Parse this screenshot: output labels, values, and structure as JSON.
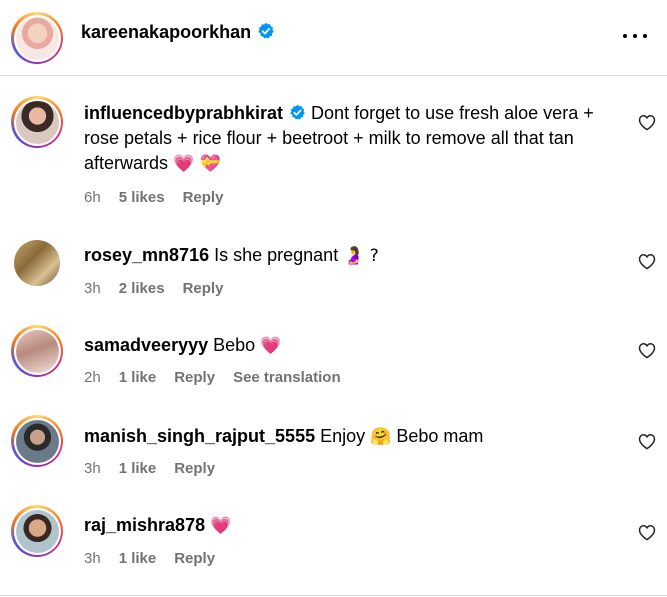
{
  "post": {
    "username": "kareenakapoorkhan",
    "verified": true,
    "more_icon": "more-horizontal-icon"
  },
  "comments": [
    {
      "username": "influencedbyprabhkirat",
      "verified": true,
      "text": "Dont forget to use fresh aloe vera + rose petals + rice flour + beetroot + milk to remove all that tan afterwards",
      "emoji": "💗 💝",
      "time": "6h",
      "likes": "5 likes",
      "reply": "Reply"
    },
    {
      "username": "rosey_mn8716",
      "text": "Is she pregnant",
      "emoji": "🤰 ?",
      "time": "3h",
      "likes": "2 likes",
      "reply": "Reply"
    },
    {
      "username": "samadveeryyy",
      "text": "Bebo",
      "emoji": "💗",
      "time": "2h",
      "likes": "1 like",
      "reply": "Reply",
      "translate": "See translation"
    },
    {
      "username": "manish_singh_rajput_5555",
      "text": "Enjoy",
      "emoji": "🤗",
      "text_after": "Bebo mam",
      "time": "3h",
      "likes": "1 like",
      "reply": "Reply"
    },
    {
      "username": "raj_mishra878",
      "text": "",
      "emoji": "💗",
      "time": "3h",
      "likes": "1 like",
      "reply": "Reply"
    }
  ],
  "colors": {
    "verified": "#0095f6",
    "secondary_text": "#737373",
    "divider": "#dbdbdb",
    "heart_emoji": "#f0386b"
  }
}
